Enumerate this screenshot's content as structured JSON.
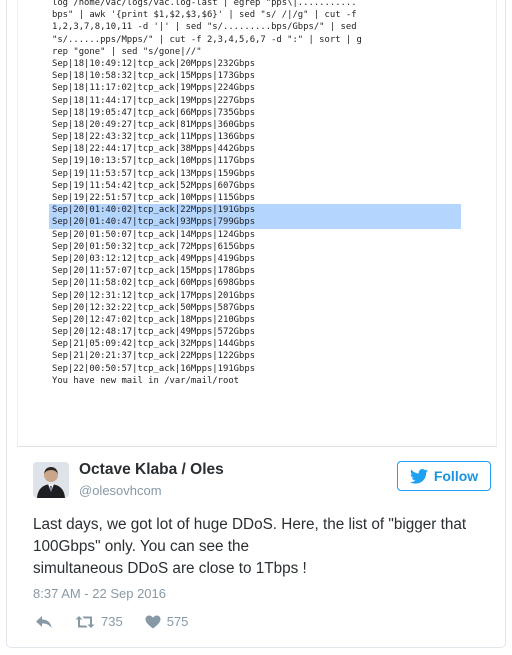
{
  "terminal": {
    "lines": [
      "log /home/vac/logs/vac.log-last | egrep \"pps\\|...........",
      "bps\" | awk '{print $1,$2,$3,$6}' | sed \"s/ /|/g\" | cut -f",
      "1,2,3,7,8,10,11 -d '|' | sed \"s/.........bps/Gbps/\" | sed",
      "\"s/......pps/Mpps/\" | cut -f 2,3,4,5,6,7 -d \":\" | sort | g",
      "rep \"gone\" | sed \"s/gone|//\"",
      "Sep|18|10:49:12|tcp_ack|20Mpps|232Gbps",
      "Sep|18|10:58:32|tcp_ack|15Mpps|173Gbps",
      "Sep|18|11:17:02|tcp_ack|19Mpps|224Gbps",
      "Sep|18|11:44:17|tcp_ack|19Mpps|227Gbps",
      "Sep|18|19:05:47|tcp_ack|66Mpps|735Gbps",
      "Sep|18|20:49:27|tcp_ack|81Mpps|360Gbps",
      "Sep|18|22:43:32|tcp_ack|11Mpps|136Gbps",
      "Sep|18|22:44:17|tcp_ack|38Mpps|442Gbps",
      "Sep|19|10:13:57|tcp_ack|10Mpps|117Gbps",
      "Sep|19|11:53:57|tcp_ack|13Mpps|159Gbps",
      "Sep|19|11:54:42|tcp_ack|52Mpps|607Gbps",
      "Sep|19|22:51:57|tcp_ack|10Mpps|115Gbps",
      "Sep|20|01:40:02|tcp_ack|22Mpps|191Gbps",
      "Sep|20|01:40:47|tcp_ack|93Mpps|799Gbps",
      "Sep|20|01:50:07|tcp_ack|14Mpps|124Gbps",
      "Sep|20|01:50:32|tcp_ack|72Mpps|615Gbps",
      "Sep|20|03:12:12|tcp_ack|49Mpps|419Gbps",
      "Sep|20|11:57:07|tcp_ack|15Mpps|178Gbps",
      "Sep|20|11:58:02|tcp_ack|60Mpps|698Gbps",
      "Sep|20|12:31:12|tcp_ack|17Mpps|201Gbps",
      "Sep|20|12:32:22|tcp_ack|50Mpps|587Gbps",
      "Sep|20|12:47:02|tcp_ack|18Mpps|210Gbps",
      "Sep|20|12:48:17|tcp_ack|49Mpps|572Gbps",
      "Sep|21|05:09:42|tcp_ack|32Mpps|144Gbps",
      "Sep|21|20:21:37|tcp_ack|22Mpps|122Gbps",
      "Sep|22|00:50:57|tcp_ack|16Mpps|191Gbps",
      "You have new mail in /var/mail/root"
    ],
    "highlighted_lines": [
      17,
      18
    ],
    "highlight_color": "#b4d5fe"
  },
  "tweet": {
    "author_name": "Octave Klaba / Oles",
    "author_handle": "@olesovhcom",
    "avatar_icon": "avatar-photo",
    "follow_label": "Follow",
    "follow_icon": "twitter-bird-icon",
    "text_lines": [
      "Last days, we got lot of huge DDoS. Here, the list of \"bigger that",
      "100Gbps\" only. You can see the",
      "simultaneous DDoS are close to 1Tbps !"
    ],
    "timestamp": "8:37 AM - 22 Sep 2016",
    "retweet_count": "735",
    "like_count": "575"
  },
  "colors": {
    "accent": "#1da1f2",
    "text": "#292f33",
    "muted": "#8899a6",
    "border": "#e1e8ed"
  }
}
